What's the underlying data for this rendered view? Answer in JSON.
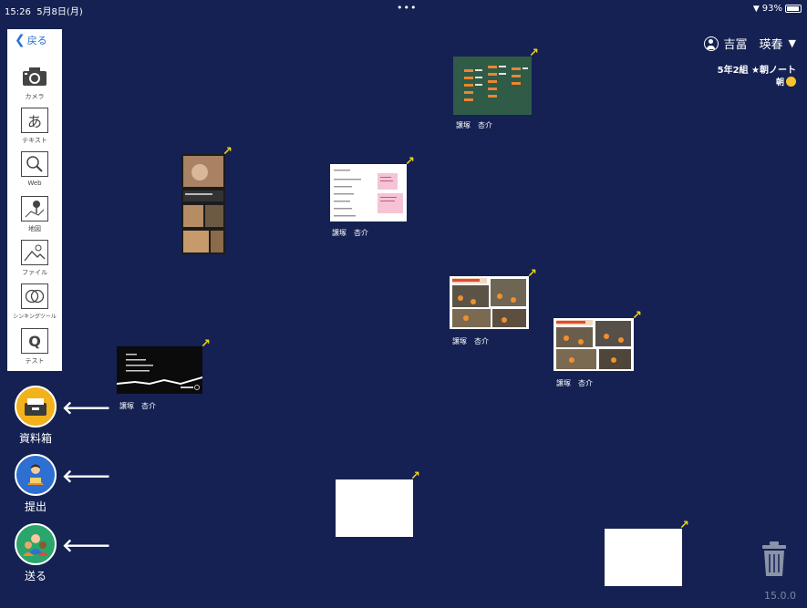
{
  "status_bar": {
    "time": "15:26",
    "date": "5月8日(月)",
    "dots": "•••",
    "battery": "93%"
  },
  "toolbar": {
    "back_label": "戻る",
    "tools": [
      {
        "label": "カメラ",
        "icon": "camera-icon"
      },
      {
        "label": "テキスト",
        "icon": "text-icon",
        "glyph": "あ"
      },
      {
        "label": "Web",
        "icon": "web-search-icon"
      },
      {
        "label": "地図",
        "icon": "map-icon"
      },
      {
        "label": "ファイル",
        "icon": "file-image-icon"
      },
      {
        "label": "シンキングツール",
        "icon": "thinking-tool-icon"
      },
      {
        "label": "テスト",
        "icon": "test-icon",
        "glyph": "Q"
      }
    ]
  },
  "actions": [
    {
      "label": "資料箱",
      "icon": "document-box-icon",
      "color": "#f2b21b"
    },
    {
      "label": "提出",
      "icon": "submit-person-icon",
      "color": "#2e6fd2"
    },
    {
      "label": "送る",
      "icon": "send-people-icon",
      "color": "#2aa56b"
    }
  ],
  "user": {
    "name": "吉冨　瑛春"
  },
  "note": {
    "title": "5年2組 ★朝ノート",
    "subtitle": "朝"
  },
  "cards": [
    {
      "author": "譲塚　杏介"
    },
    {
      "author": ""
    },
    {
      "author": "譲塚　杏介"
    },
    {
      "author": "譲塚　杏介"
    },
    {
      "author": "譲塚　杏介"
    },
    {
      "author": "譲塚　杏介"
    },
    {
      "author": ""
    },
    {
      "author": ""
    }
  ],
  "version": "15.0.0",
  "colors": {
    "background": "#142152",
    "arrow": "#f1d21a",
    "back_link": "#2b6fd6"
  }
}
